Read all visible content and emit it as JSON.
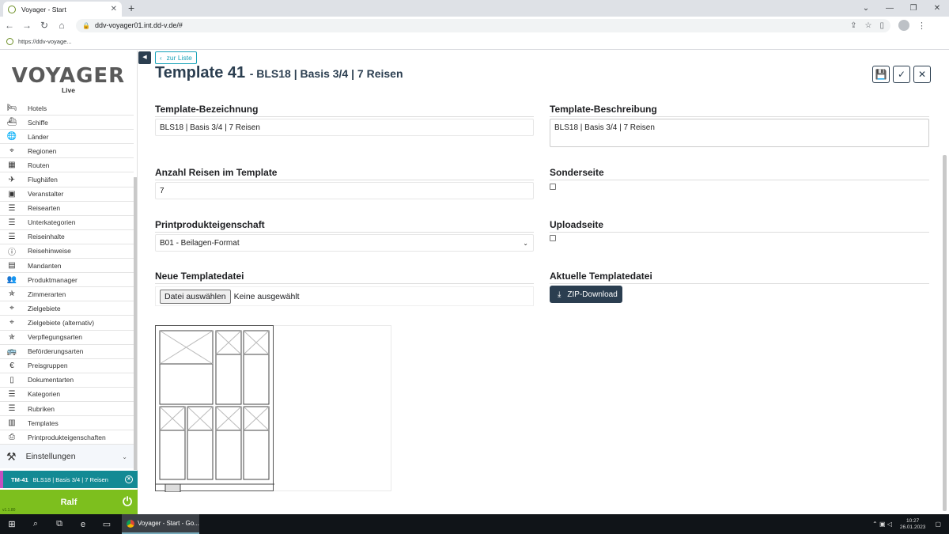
{
  "browser": {
    "tab_title": "Voyager - Start",
    "url": "ddv-voyager01.int.dd-v.de/#",
    "bookmark": "https://ddv-voyage..."
  },
  "logo": {
    "text": "VOYAGER",
    "sub": "Live"
  },
  "sidebar": {
    "items": [
      {
        "label": "Hotels",
        "icon": "bed-icon"
      },
      {
        "label": "Schiffe",
        "icon": "ship-icon"
      },
      {
        "label": "Länder",
        "icon": "globe-icon"
      },
      {
        "label": "Regionen",
        "icon": "map-pin-icon"
      },
      {
        "label": "Routen",
        "icon": "map-icon"
      },
      {
        "label": "Flughäfen",
        "icon": "plane-icon"
      },
      {
        "label": "Veranstalter",
        "icon": "contact-icon"
      },
      {
        "label": "Reisearten",
        "icon": "list-icon"
      },
      {
        "label": "Unterkategorien",
        "icon": "list-icon"
      },
      {
        "label": "Reiseinhalte",
        "icon": "list-icon"
      },
      {
        "label": "Reisehinweise",
        "icon": "info-icon"
      },
      {
        "label": "Mandanten",
        "icon": "id-card-icon"
      },
      {
        "label": "Produktmanager",
        "icon": "users-icon"
      },
      {
        "label": "Zimmerarten",
        "icon": "star-person-icon"
      },
      {
        "label": "Zielgebiete",
        "icon": "map-pin-icon"
      },
      {
        "label": "Zielgebiete (alternativ)",
        "icon": "map-pin-icon"
      },
      {
        "label": "Verpflegungsarten",
        "icon": "star-person-icon"
      },
      {
        "label": "Beförderungsarten",
        "icon": "bus-icon"
      },
      {
        "label": "Preisgruppen",
        "icon": "euro-icon"
      },
      {
        "label": "Dokumentarten",
        "icon": "document-icon"
      },
      {
        "label": "Kategorien",
        "icon": "list-icon"
      },
      {
        "label": "Rubriken",
        "icon": "list-icon"
      },
      {
        "label": "Templates",
        "icon": "template-icon"
      },
      {
        "label": "Printprodukteigenschaften",
        "icon": "print-icon"
      }
    ],
    "settings_label": "Einstellungen",
    "open_tab": {
      "id": "TM-41",
      "title": "BLS18 | Basis 3/4 | 7 Reisen"
    },
    "user": "Ralf",
    "version": "v1.1.80"
  },
  "header": {
    "back_label": "zur Liste",
    "title": "Template 41",
    "subtitle": "- BLS18 | Basis 3/4 | 7 Reisen"
  },
  "form": {
    "bezeichnung_label": "Template-Bezeichnung",
    "bezeichnung_value": "BLS18 | Basis 3/4 | 7 Reisen",
    "beschreibung_label": "Template-Beschreibung",
    "beschreibung_value": "BLS18 | Basis 3/4 | 7 Reisen",
    "anzahl_label": "Anzahl Reisen im Template",
    "anzahl_value": "7",
    "sonderseite_label": "Sonderseite",
    "printprodukt_label": "Printprodukteigenschaft",
    "printprodukt_value": "B01 - Beilagen-Format",
    "uploadseite_label": "Uploadseite",
    "neue_datei_label": "Neue Templatedatei",
    "file_button": "Datei auswählen",
    "file_status": "Keine ausgewählt",
    "aktuelle_datei_label": "Aktuelle Templatedatei",
    "zip_button": "ZIP-Download"
  },
  "taskbar": {
    "app_label": "Voyager - Start - Go...",
    "time": "10:27",
    "date": "26.01.2023"
  }
}
